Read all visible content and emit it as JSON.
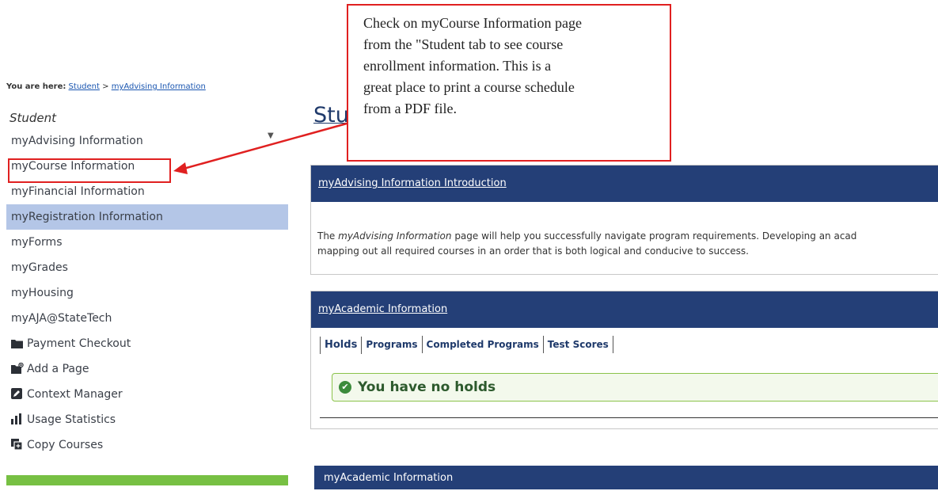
{
  "breadcrumb": {
    "prefix": "You are here:",
    "items": [
      "Student",
      ">",
      "myAdvising Information"
    ]
  },
  "sidebar": {
    "title": "Student",
    "items": [
      {
        "label": "myAdvising Information",
        "icon": "",
        "active": false
      },
      {
        "label": "myCourse Information",
        "icon": "",
        "active": false
      },
      {
        "label": "myFinancial Information",
        "icon": "",
        "active": false
      },
      {
        "label": "myRegistration Information",
        "icon": "",
        "active": true
      },
      {
        "label": "myForms",
        "icon": "",
        "active": false
      },
      {
        "label": "myGrades",
        "icon": "",
        "active": false
      },
      {
        "label": "myHousing",
        "icon": "",
        "active": false
      },
      {
        "label": "myAJA@StateTech",
        "icon": "",
        "active": false
      },
      {
        "label": "Payment Checkout",
        "icon": "folder-icon",
        "active": false
      },
      {
        "label": "Add a Page",
        "icon": "add-page-icon",
        "active": false
      },
      {
        "label": "Context Manager",
        "icon": "edit-icon",
        "active": false
      },
      {
        "label": "Usage Statistics",
        "icon": "bar-chart-icon",
        "active": false
      },
      {
        "label": "Copy Courses",
        "icon": "copy-icon",
        "active": false
      }
    ]
  },
  "main": {
    "heading": "Stu",
    "panels": [
      {
        "title": "myAdvising Information Introduction",
        "body": {
          "before": "The ",
          "emphasis": "myAdvising Information",
          "after": " page will help you successfully navigate program requirements.  Developing an acad",
          "line2": "mapping out all required courses in an order that is both logical and conducive to success."
        }
      },
      {
        "title": "myAcademic Information",
        "tabs": [
          "Holds",
          "Programs",
          "Completed Programs",
          "Test Scores"
        ],
        "alert": "You have no holds"
      },
      {
        "title": "myAcademic Information"
      }
    ]
  },
  "callout": {
    "lines": [
      "Check on myCourse Information page",
      "from the \"Student tab to see course",
      "enrollment information.  This is a",
      "great place to print a course schedule",
      "from a PDF file."
    ]
  },
  "colors": {
    "header_navy": "#243f77",
    "active_item": "#b4c6e7",
    "annotation_red": "#e02020",
    "green_bar": "#77c043",
    "alert_border": "#8bc34a"
  }
}
